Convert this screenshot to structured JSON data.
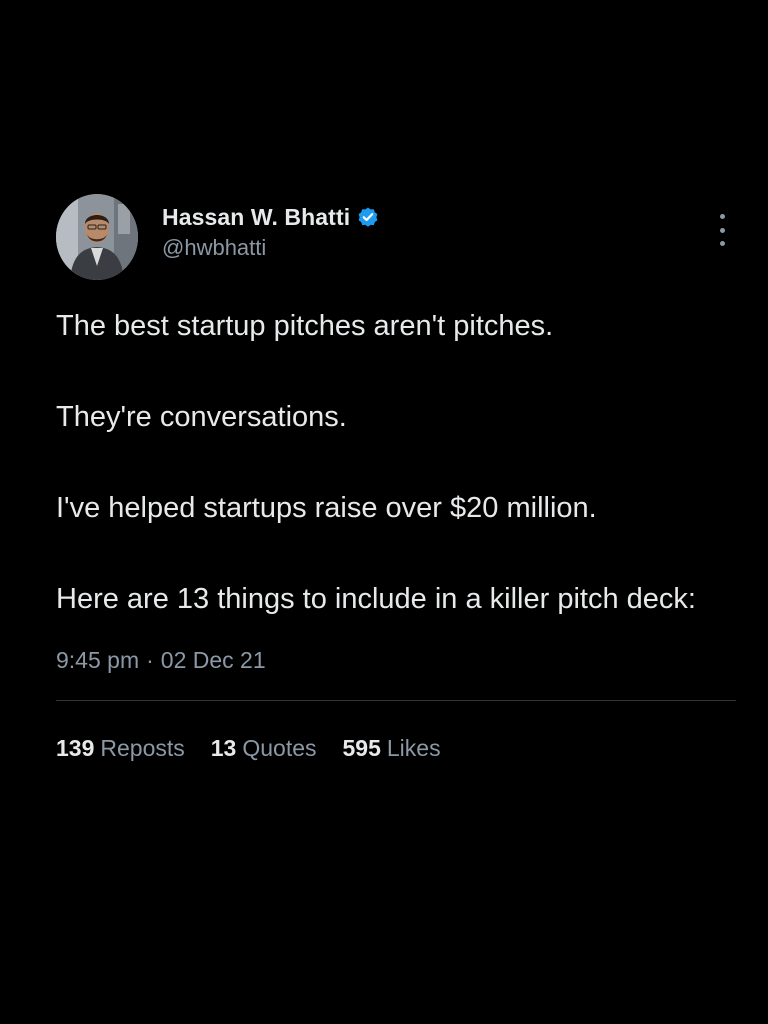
{
  "author": {
    "display_name": "Hassan W. Bhatti",
    "handle": "@hwbhatti",
    "verified": true,
    "verified_color": "#1d9bf0"
  },
  "tweet": {
    "paragraphs": [
      "The best startup pitches aren't pitches.",
      "They're conversations.",
      "I've helped startups raise over $20 million.",
      "Here are 13 things to include in a killer pitch deck:"
    ],
    "time": "9:45 pm",
    "separator": "·",
    "date": "02 Dec 21"
  },
  "stats": {
    "reposts": {
      "count": "139",
      "label": "Reposts"
    },
    "quotes": {
      "count": "13",
      "label": "Quotes"
    },
    "likes": {
      "count": "595",
      "label": "Likes"
    }
  },
  "icons": {
    "more": "more-vertical-icon",
    "verified": "verified-badge-icon"
  },
  "colors": {
    "background": "#000000",
    "text_primary": "#e7e9ea",
    "text_secondary": "#8b98a5",
    "divider": "#2f3336"
  }
}
